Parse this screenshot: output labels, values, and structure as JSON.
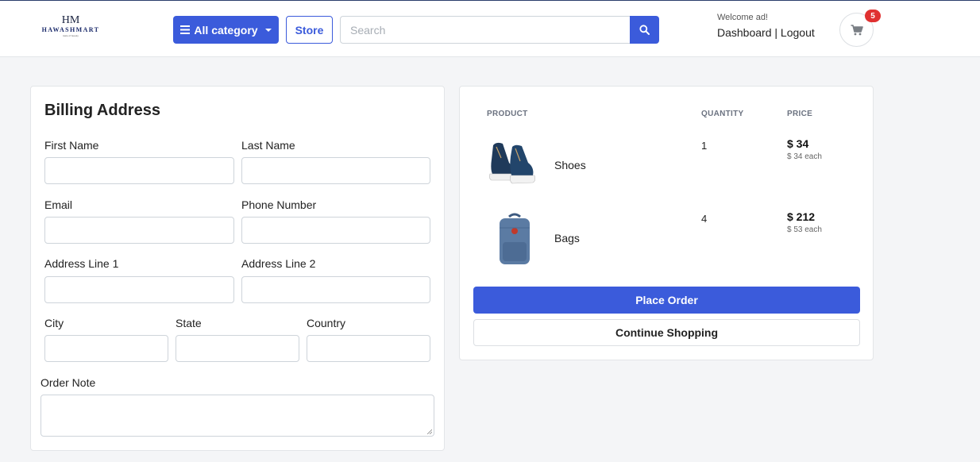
{
  "header": {
    "logo": {
      "mark": "HM",
      "name": "HAWASHMART",
      "tagline": "taste of beauty"
    },
    "category_button": "All category",
    "store_button": "Store",
    "search": {
      "placeholder": "Search",
      "value": ""
    },
    "welcome": "Welcome ad!",
    "dashboard_link": "Dashboard",
    "separator": "|",
    "logout_link": "Logout",
    "cart_count": "5"
  },
  "billing": {
    "title": "Billing Address",
    "labels": {
      "first_name": "First Name",
      "last_name": "Last Name",
      "email": "Email",
      "phone": "Phone Number",
      "address1": "Address Line 1",
      "address2": "Address Line 2",
      "city": "City",
      "state": "State",
      "country": "Country",
      "order_note": "Order Note"
    }
  },
  "summary": {
    "headers": {
      "product": "PRODUCT",
      "quantity": "QUANTITY",
      "price": "PRICE"
    },
    "items": [
      {
        "name": "Shoes",
        "quantity": "1",
        "price": "$ 34",
        "each": "$ 34 each"
      },
      {
        "name": "Bags",
        "quantity": "4",
        "price": "$ 212",
        "each": "$ 53 each"
      }
    ],
    "place_order": "Place Order",
    "continue_shopping": "Continue Shopping"
  },
  "colors": {
    "primary": "#3b5bdb",
    "badge": "#e03131",
    "background": "#f4f5f7"
  }
}
